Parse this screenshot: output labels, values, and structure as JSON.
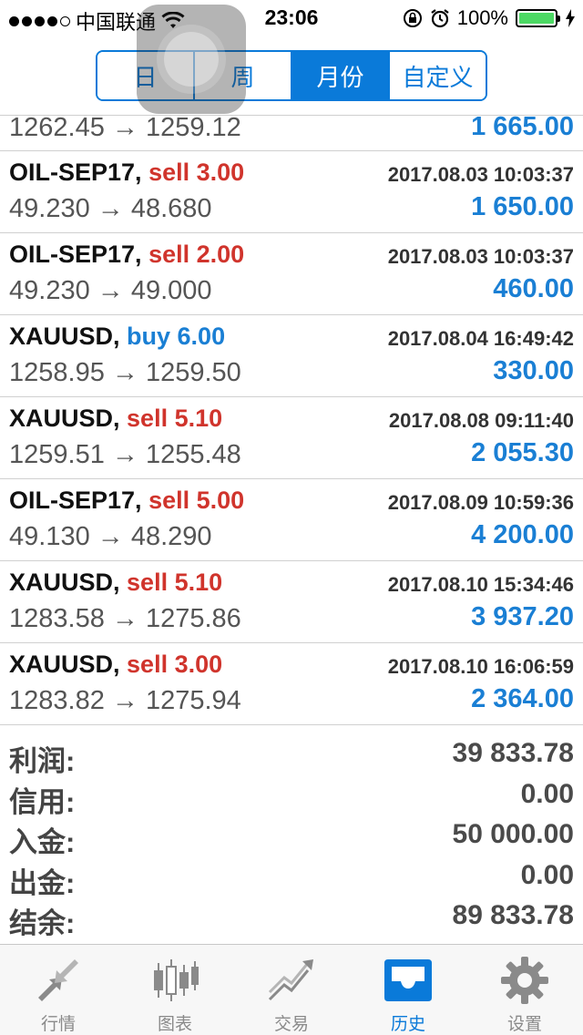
{
  "status_bar": {
    "carrier": "中国联通",
    "time": "23:06",
    "battery": "100%"
  },
  "segments": [
    {
      "label": "日",
      "active": false
    },
    {
      "label": "周",
      "active": false
    },
    {
      "label": "月份",
      "active": true
    },
    {
      "label": "自定义",
      "active": false
    }
  ],
  "partial_deal": {
    "prices": "1262.45 → 1259.12",
    "profit": "1 665.00"
  },
  "deals": [
    {
      "symbol": "OIL-SEP17,",
      "action": "sell 3.00",
      "side": "sell",
      "time": "2017.08.03 10:03:37",
      "prices": "49.230 → 48.680",
      "profit": "1 650.00"
    },
    {
      "symbol": "OIL-SEP17,",
      "action": "sell 2.00",
      "side": "sell",
      "time": "2017.08.03 10:03:37",
      "prices": "49.230 → 49.000",
      "profit": "460.00"
    },
    {
      "symbol": "XAUUSD,",
      "action": "buy 6.00",
      "side": "buy",
      "time": "2017.08.04 16:49:42",
      "prices": "1258.95 → 1259.50",
      "profit": "330.00"
    },
    {
      "symbol": "XAUUSD,",
      "action": "sell 5.10",
      "side": "sell",
      "time": "2017.08.08 09:11:40",
      "prices": "1259.51 → 1255.48",
      "profit": "2 055.30"
    },
    {
      "symbol": "OIL-SEP17,",
      "action": "sell 5.00",
      "side": "sell",
      "time": "2017.08.09 10:59:36",
      "prices": "49.130 → 48.290",
      "profit": "4 200.00"
    },
    {
      "symbol": "XAUUSD,",
      "action": "sell 5.10",
      "side": "sell",
      "time": "2017.08.10 15:34:46",
      "prices": "1283.58 → 1275.86",
      "profit": "3 937.20"
    },
    {
      "symbol": "XAUUSD,",
      "action": "sell 3.00",
      "side": "sell",
      "time": "2017.08.10 16:06:59",
      "prices": "1283.82 → 1275.94",
      "profit": "2 364.00"
    }
  ],
  "summary": [
    {
      "label": "利润:",
      "value": "39 833.78"
    },
    {
      "label": "信用:",
      "value": "0.00"
    },
    {
      "label": "入金:",
      "value": "50 000.00"
    },
    {
      "label": "出金:",
      "value": "0.00"
    },
    {
      "label": "结余:",
      "value": "89 833.78"
    }
  ],
  "tabs": [
    {
      "label": "行情",
      "icon": "quotes-arrows-icon",
      "active": false
    },
    {
      "label": "图表",
      "icon": "candlestick-chart-icon",
      "active": false
    },
    {
      "label": "交易",
      "icon": "trade-trend-icon",
      "active": false
    },
    {
      "label": "历史",
      "icon": "inbox-tray-icon",
      "active": true
    },
    {
      "label": "设置",
      "icon": "gear-icon",
      "active": false
    }
  ],
  "colors": {
    "accent": "#0a7ad9",
    "sell": "#d0342c",
    "buy": "#1a7fd4",
    "profit": "#1a7fd4"
  }
}
